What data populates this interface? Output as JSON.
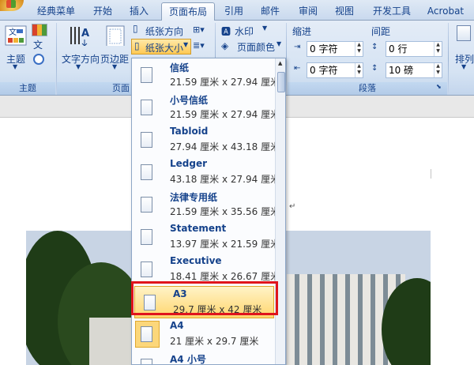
{
  "tabs": [
    "经典菜单",
    "开始",
    "插入",
    "页面布局",
    "引用",
    "邮件",
    "审阅",
    "视图",
    "开发工具",
    "Acrobat"
  ],
  "active_tab": "页面布局",
  "ribbon": {
    "theme_group": {
      "label": "主题",
      "theme_button": "主题"
    },
    "page_setup_group": {
      "label_partial": "页面",
      "text_direction": "文字方向",
      "margins": "页边距",
      "orientation": "纸张方向",
      "size": "纸张大小"
    },
    "background_group": {
      "watermark": "水印",
      "page_color": "页面颜色"
    },
    "paragraph_group": {
      "label": "段落",
      "indent_label": "缩进",
      "spacing_label": "间距",
      "indent_left": "0 字符",
      "indent_right": "0 字符",
      "spacing_before": "0 行",
      "spacing_after": "10 磅"
    },
    "arrange_group": {
      "arrange": "排列"
    }
  },
  "paper_sizes": [
    {
      "name": "信纸",
      "dims": "21.59 厘米 x 27.94 厘米",
      "state": "normal"
    },
    {
      "name": "小号信纸",
      "dims": "21.59 厘米 x 27.94 厘米",
      "state": "normal"
    },
    {
      "name": "Tabloid",
      "dims": "27.94 厘米 x 43.18 厘米",
      "state": "normal"
    },
    {
      "name": "Ledger",
      "dims": "43.18 厘米 x 27.94 厘米",
      "state": "normal"
    },
    {
      "name": "法律专用纸",
      "dims": "21.59 厘米 x 35.56 厘米",
      "state": "normal"
    },
    {
      "name": "Statement",
      "dims": "13.97 厘米 x 21.59 厘米",
      "state": "normal"
    },
    {
      "name": "Executive",
      "dims": "18.41 厘米 x 26.67 厘米",
      "state": "normal"
    },
    {
      "name": "A3",
      "dims": "29.7 厘米 x 42 厘米",
      "state": "hover"
    },
    {
      "name": "A4",
      "dims": "21 厘米 x 29.7 厘米",
      "state": "checked"
    },
    {
      "name": "A4 小号",
      "dims": "",
      "state": "normal"
    }
  ],
  "colors": {
    "highlight_border": "#e0141c",
    "hover_fill": "#ffd66e",
    "ribbon_text": "#15428b"
  }
}
